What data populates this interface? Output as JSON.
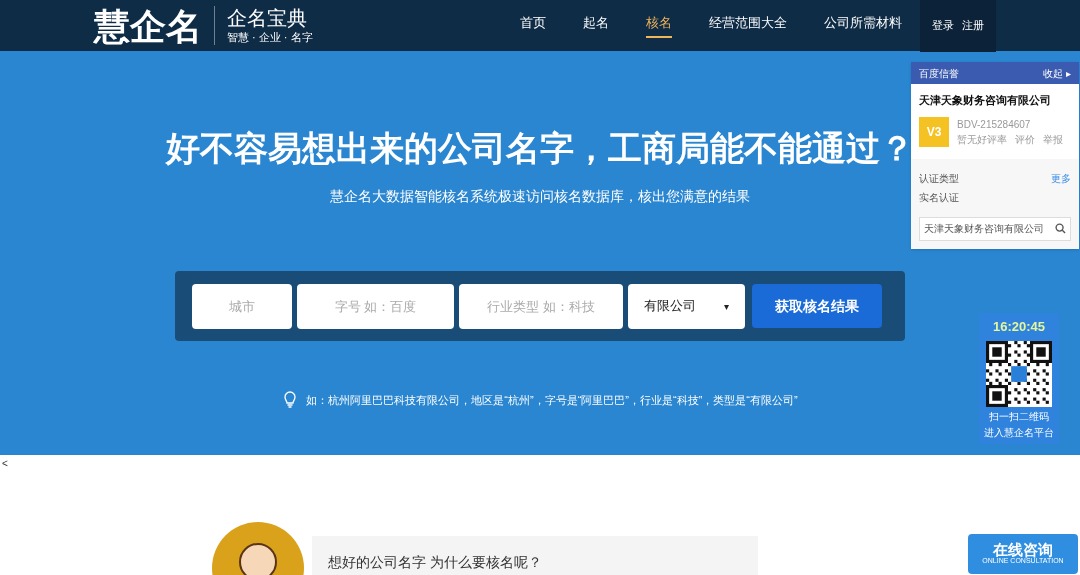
{
  "header": {
    "logo": "慧企名",
    "logo_sub_title": "企名宝典",
    "logo_tagline": "智慧 · 企业 · 名字",
    "nav": [
      {
        "label": "首页",
        "selected": false
      },
      {
        "label": "起名",
        "selected": false
      },
      {
        "label": "核名",
        "selected": true
      },
      {
        "label": "经营范围大全",
        "selected": false
      },
      {
        "label": "公司所需材料",
        "selected": false
      }
    ],
    "auth": [
      "登录",
      "注册"
    ]
  },
  "hero": {
    "title": "好不容易想出来的公司名字，工商局能不能通过？",
    "subtitle": "慧企名大数据智能核名系统极速访问核名数据库，核出您满意的结果",
    "fields": [
      {
        "placeholder": "城市"
      },
      {
        "placeholder": "字号 如：百度"
      },
      {
        "placeholder": "行业类型 如：科技"
      }
    ],
    "select": {
      "value": "有限公司",
      "arrow": "▾"
    },
    "submit": "获取核名结果",
    "hint": "如：杭州阿里巴巴科技有限公司，地区是“杭州”，字号是“阿里巴巴”，行业是“科技”，类型是“有限公司”"
  },
  "verify_panel": {
    "brand": "百度信誉",
    "collapse": "收起",
    "collapse_arrow": "▸",
    "company": "天津天象财务咨询有限公司",
    "badge": "V3",
    "code": "BDV-215284607",
    "reviews": "暂无好评率",
    "rate": "评价",
    "report": "举报",
    "cert_label": "认证类型",
    "more": "更多",
    "cert_value": "实名认证",
    "search_value": "天津天象财务咨询有限公司"
  },
  "qr_widget": {
    "time": "16:20:45",
    "caption": [
      "扫一扫二维码",
      "进入慧企名平台"
    ]
  },
  "prev_arrow": "<",
  "chat": {
    "question": "想好的公司名字 为什么要核名呢？"
  },
  "consult": {
    "label": "在线咨询",
    "sub": "ONLINE CONSULTATION"
  }
}
